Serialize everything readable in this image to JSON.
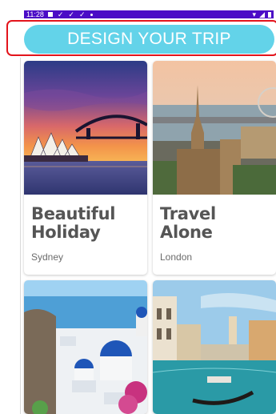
{
  "status_bar": {
    "time": "11:28",
    "bg_color": "#4b0cc6"
  },
  "header": {
    "button_label": "DESIGN YOUR TRIP",
    "button_color": "#63d3e9",
    "highlight_color": "#e3141c"
  },
  "cards": [
    {
      "title": "Beautiful\nHoliday",
      "subtitle": "Sydney"
    },
    {
      "title": "Travel\nAlone",
      "subtitle": "London"
    },
    {
      "title": "",
      "subtitle": ""
    },
    {
      "title": "",
      "subtitle": ""
    }
  ]
}
